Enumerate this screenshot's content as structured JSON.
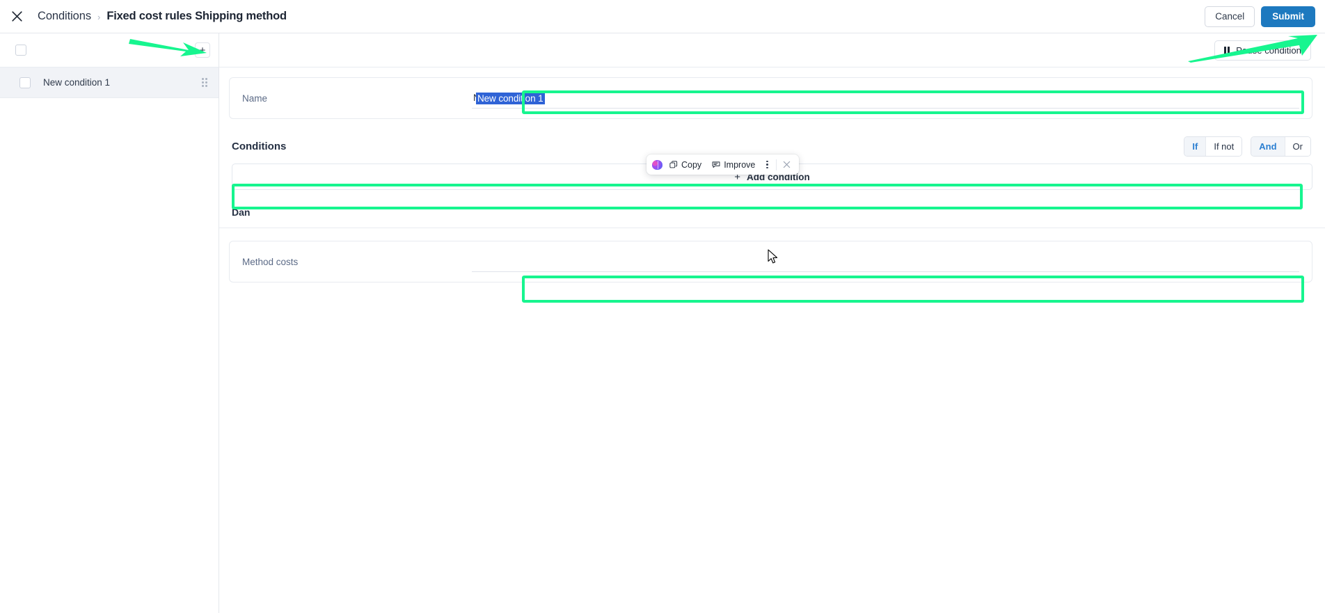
{
  "topbar": {
    "close_icon": "close-icon",
    "breadcrumb": {
      "root": "Conditions",
      "separator": "›",
      "current": "Fixed cost rules Shipping method"
    },
    "cancel_label": "Cancel",
    "submit_label": "Submit",
    "submit_color": "#1d79bf"
  },
  "sidebar": {
    "select_all_checkbox": "",
    "add_button_label": "+",
    "rows": [
      {
        "label": "New condition 1",
        "checked": false,
        "selected": true
      }
    ]
  },
  "main": {
    "pause_button_label": "Pause condition",
    "name_field": {
      "label": "Name",
      "value": "New condition 1",
      "selected_text": "New condition 1",
      "selection_color": "#2f63d6"
    },
    "conditions": {
      "title": "Conditions",
      "segment_if": [
        {
          "label": "If",
          "active": true
        },
        {
          "label": "If not",
          "active": false
        }
      ],
      "segment_join": [
        {
          "label": "And",
          "active": true
        },
        {
          "label": "Or",
          "active": false
        }
      ],
      "add_condition_label": "Add condition",
      "add_condition_plus": "+"
    },
    "section_title": "Dan",
    "method_costs_field": {
      "label": "Method costs",
      "value": "",
      "placeholder": ""
    }
  },
  "ai_toolbar": {
    "brain_icon": "ai-brain-icon",
    "copy_label": "Copy",
    "improve_label": "Improve",
    "more_icon": "kebab-menu-icon",
    "close_icon": "close-icon"
  },
  "annotations": {
    "highlight_color": "#17f58f",
    "boxes": [
      "name-input",
      "add-condition-button",
      "method-costs-input"
    ],
    "arrows": [
      "arrow-to-add-button",
      "arrow-to-submit-button"
    ]
  }
}
